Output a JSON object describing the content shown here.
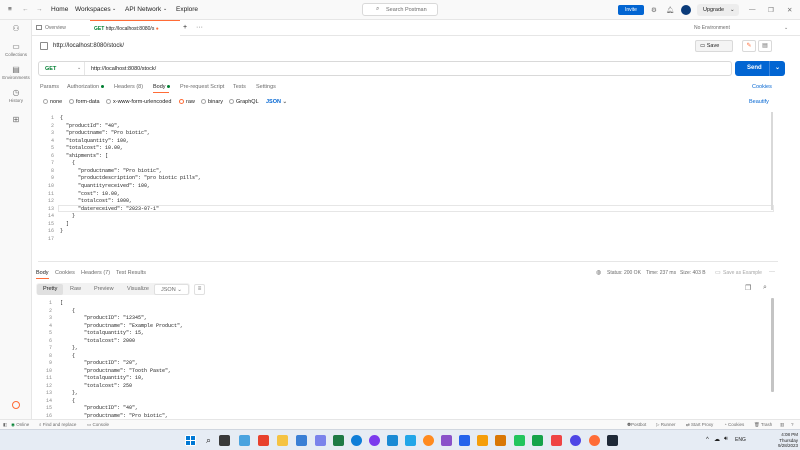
{
  "topbar": {
    "nav": [
      "Home",
      "Workspaces",
      "API Network",
      "Explore"
    ],
    "search_placeholder": "Search Postman",
    "invite_label": "Invite",
    "upgrade_label": "Upgrade"
  },
  "sidebar": {
    "items": [
      {
        "label": "",
        "icon": "user-icon"
      },
      {
        "label": "Collections",
        "icon": "collections-icon"
      },
      {
        "label": "Environments",
        "icon": "environments-icon"
      },
      {
        "label": "History",
        "icon": "history-icon"
      },
      {
        "label": "",
        "icon": "apps-icon"
      }
    ]
  },
  "tabs": {
    "overview": "Overview",
    "active_method": "GET",
    "active_url": "http://localhost:8080/s",
    "environment": "No Environment"
  },
  "request": {
    "title": "http://localhost:8080/stock/",
    "save_label": "Save",
    "method": "GET",
    "url": "http://localhost:8080/stock/",
    "send_label": "Send",
    "tabs": [
      "Params",
      "Authorization",
      "Headers (8)",
      "Body",
      "Pre-request Script",
      "Tests",
      "Settings"
    ],
    "cookies_label": "Cookies",
    "beautify_label": "Beautify",
    "body_modes": [
      "none",
      "form-data",
      "x-www-form-urlencoded",
      "raw",
      "binary",
      "GraphQL"
    ],
    "body_lang": "JSON",
    "code_lines": [
      "{",
      "  \"productId\": \"40\",",
      "  \"productname\": \"Pro biotic\",",
      "  \"totalquantity\": 100,",
      "  \"totalcost\": 10.00,",
      "  \"shipments\": [",
      "    {",
      "      \"productname\": \"Pro biotic\",",
      "      \"productdescription\": \"pro biotic pills\",",
      "      \"quantityreceived\": 100,",
      "      \"cost\": 10.00,",
      "      \"totalcost\": 1000,",
      "      \"datereceived\": \"2023-07-1\"",
      "    }",
      "  ]",
      "}",
      ""
    ]
  },
  "response": {
    "tabs": [
      "Body",
      "Cookies",
      "Headers (7)",
      "Test Results"
    ],
    "status": "Status: 200 OK",
    "time": "Time: 237 ms",
    "size": "Size: 403 B",
    "save_example": "Save as Example",
    "views": [
      "Pretty",
      "Raw",
      "Preview",
      "Visualize"
    ],
    "lang": "JSON",
    "code_lines": [
      "[",
      "    {",
      "        \"productID\": \"12345\",",
      "        \"productname\": \"Example Product\",",
      "        \"totalquantity\": 15,",
      "        \"totalcost\": 2000",
      "    },",
      "    {",
      "        \"productID\": \"20\",",
      "        \"productname\": \"Tooth Paste\",",
      "        \"totalquantity\": 10,",
      "        \"totalcost\": 250",
      "    },",
      "    {",
      "        \"productID\": \"40\",",
      "        \"productname\": \"Pro biotic\","
    ]
  },
  "statusbar": {
    "online": "Online",
    "find_replace": "Find and replace",
    "console": "Console",
    "postbot": "Postbot",
    "runner": "Runner",
    "start_proxy": "Start Proxy",
    "cookies": "Cookies",
    "trash": "Trash"
  },
  "taskbar": {
    "lang": "ENG",
    "time": "4:08 PM",
    "day": "Thursday",
    "date": "9/28/2023"
  },
  "colors": {
    "accent": "#ff6c37",
    "primary": "#0265d2",
    "get": "#007f31"
  }
}
